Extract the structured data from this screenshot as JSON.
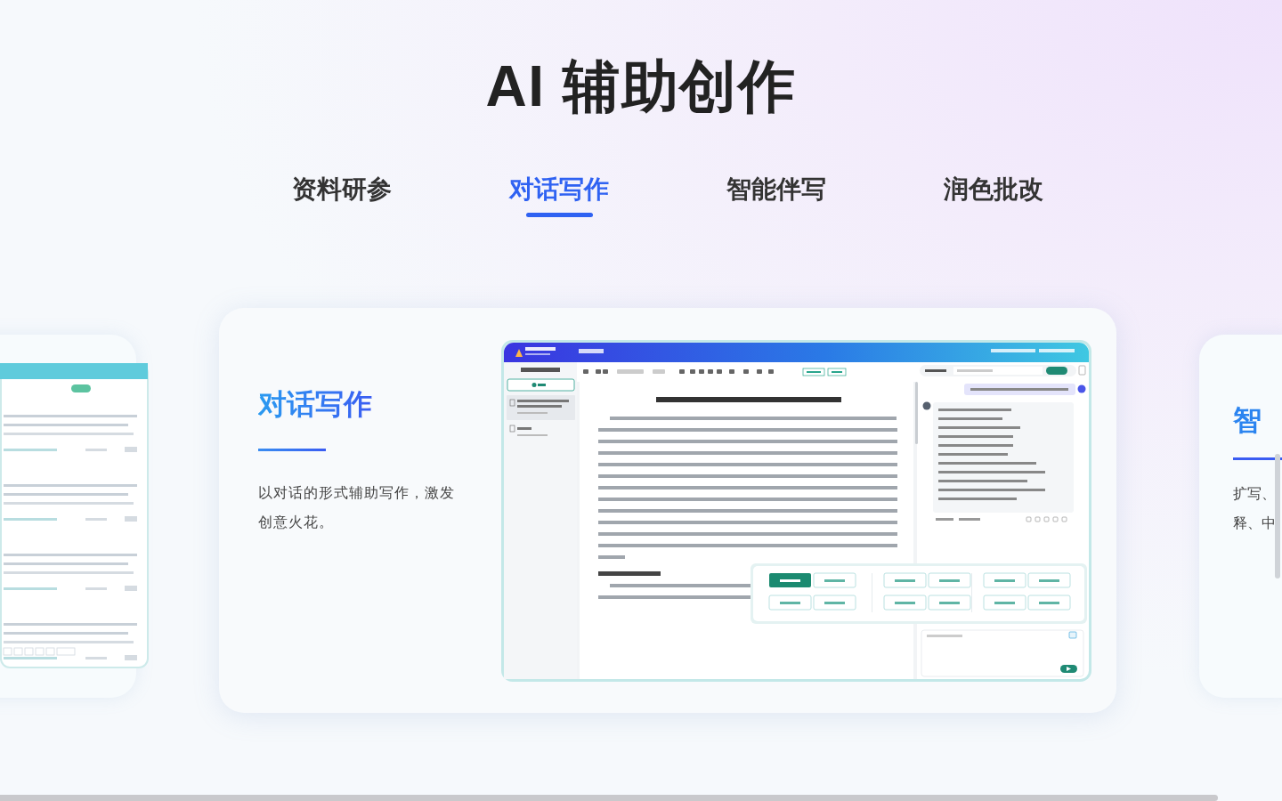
{
  "heading": "AI 辅助创作",
  "tabs": [
    {
      "label": "资料研参",
      "selected": false
    },
    {
      "label": "对话写作",
      "selected": true
    },
    {
      "label": "智能伴写",
      "selected": false
    },
    {
      "label": "润色批改",
      "selected": false
    }
  ],
  "feature": {
    "title": "对话写作",
    "description": "以对话的形式辅助写作，激发创意火花。"
  },
  "right_card": {
    "title": "智",
    "lines": [
      "扩写、",
      "释、中"
    ]
  }
}
